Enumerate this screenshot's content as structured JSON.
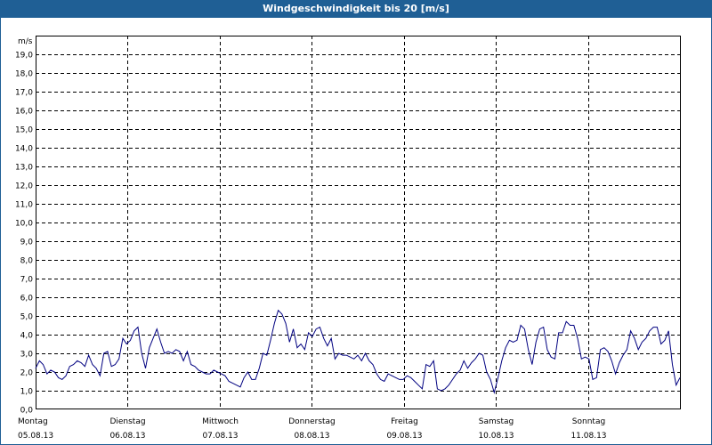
{
  "window": {
    "title": "Windgeschwindigkeit bis 20 [m/s]"
  },
  "colors": {
    "titlebar": "#1f5f95",
    "series": "#000080",
    "grid": "#000000",
    "frame": "#1f5f95"
  },
  "chart_data": {
    "type": "line",
    "title": "Windgeschwindigkeit bis 20 [m/s]",
    "ylabel": "m/s",
    "xlabel": "",
    "ylim": [
      0,
      20
    ],
    "xlim": [
      0,
      7
    ],
    "y_ticks": [
      "0,0",
      "1,0",
      "2,0",
      "3,0",
      "4,0",
      "5,0",
      "6,0",
      "7,0",
      "8,0",
      "9,0",
      "10,0",
      "11,0",
      "12,0",
      "13,0",
      "14,0",
      "15,0",
      "16,0",
      "17,0",
      "18,0",
      "19,0"
    ],
    "x_ticks": [
      {
        "day": "Montag",
        "date": "05.08.13"
      },
      {
        "day": "Dienstag",
        "date": "06.08.13"
      },
      {
        "day": "Mittwoch",
        "date": "07.08.13"
      },
      {
        "day": "Donnerstag",
        "date": "08.08.13"
      },
      {
        "day": "Freitag",
        "date": "09.08.13"
      },
      {
        "day": "Samstag",
        "date": "10.08.13"
      },
      {
        "day": "Sonntag",
        "date": "11.08.13"
      }
    ],
    "grid": true,
    "series": [
      {
        "values": [
          2.2,
          2.6,
          2.4,
          1.9,
          2.1,
          2.0,
          1.7,
          1.6,
          1.8,
          2.3,
          2.4,
          2.6,
          2.5,
          2.3,
          2.9,
          2.4,
          2.2,
          1.8,
          3.0,
          3.1,
          2.3,
          2.4,
          2.7,
          3.8,
          3.5,
          3.7,
          4.2,
          4.4,
          3.0,
          2.2,
          3.3,
          3.8,
          4.3,
          3.6,
          3.0,
          3.1,
          3.0,
          3.2,
          3.1,
          2.6,
          3.1,
          2.4,
          2.3,
          2.1,
          2.0,
          1.9,
          1.9,
          2.1,
          2.0,
          1.9,
          1.8,
          1.5,
          1.4,
          1.3,
          1.2,
          1.7,
          2.0,
          1.6,
          1.6,
          2.2,
          3.0,
          2.9,
          3.7,
          4.6,
          5.3,
          5.1,
          4.6,
          3.6,
          4.3,
          3.3,
          3.5,
          3.2,
          4.1,
          3.9,
          4.3,
          4.4,
          3.8,
          3.4,
          3.8,
          2.7,
          3.0,
          2.9,
          2.9,
          2.8,
          2.7,
          2.9,
          2.6,
          3.0,
          2.6,
          2.4,
          1.9,
          1.6,
          1.5,
          1.9,
          1.8,
          1.7,
          1.6,
          1.6,
          1.8,
          1.7,
          1.5,
          1.3,
          1.1,
          2.4,
          2.3,
          2.6,
          1.1,
          1.0,
          1.1,
          1.3,
          1.6,
          1.9,
          2.1,
          2.6,
          2.2,
          2.5,
          2.7,
          3.0,
          2.9,
          2.0,
          1.6,
          0.9,
          1.7,
          2.6,
          3.3,
          3.7,
          3.6,
          3.7,
          4.5,
          4.3,
          3.2,
          2.4,
          3.6,
          4.3,
          4.4,
          3.2,
          2.8,
          2.7,
          4.1,
          4.1,
          4.7,
          4.5,
          4.5,
          3.8,
          2.7,
          2.8,
          2.7,
          1.6,
          1.7,
          3.2,
          3.3,
          3.1,
          2.6,
          1.9,
          2.5,
          2.9,
          3.2,
          4.2,
          3.8,
          3.2,
          3.6,
          3.8,
          4.2,
          4.4,
          4.4,
          3.5,
          3.7,
          4.2,
          2.4,
          1.3,
          1.7
        ]
      }
    ]
  }
}
